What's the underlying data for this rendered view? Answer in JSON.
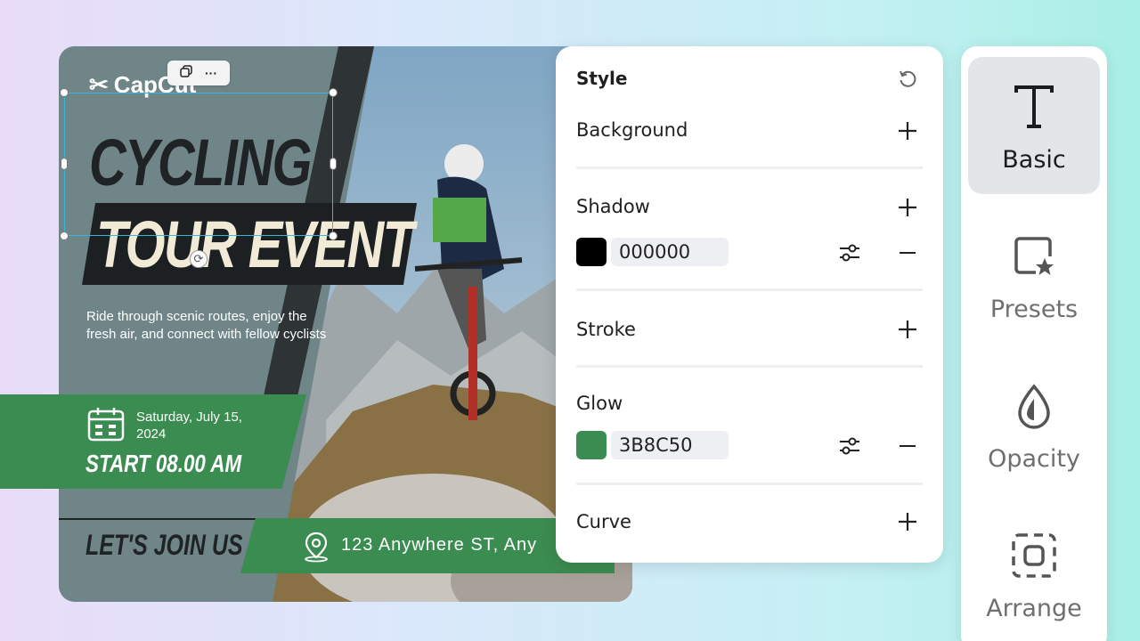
{
  "poster": {
    "logo": "CapCut",
    "title_line1": "CYCLING",
    "title_line2": "TOUR EVENT",
    "description": "Ride through scenic routes, enjoy the fresh air, and connect with fellow cyclists",
    "date": "Saturday, July 15, 2024",
    "start_time": "START 08.00 AM",
    "cta": "LET'S JOIN US",
    "address": "123 Anywhere ST, Any"
  },
  "style_panel": {
    "title": "Style",
    "background_label": "Background",
    "shadow_label": "Shadow",
    "shadow_color": "000000",
    "stroke_label": "Stroke",
    "glow_label": "Glow",
    "glow_color": "3B8C50",
    "curve_label": "Curve"
  },
  "rail": {
    "items": [
      {
        "label": "Basic",
        "icon": "text-t-icon",
        "active": true
      },
      {
        "label": "Presets",
        "icon": "presets-icon",
        "active": false
      },
      {
        "label": "Opacity",
        "icon": "opacity-drop-icon",
        "active": false
      },
      {
        "label": "Arrange",
        "icon": "arrange-icon",
        "active": false
      }
    ]
  },
  "colors": {
    "accent_green": "#3B8C50",
    "shadow_swatch": "#000000",
    "poster_slate": "#6f8587",
    "dark": "#1f2326"
  }
}
